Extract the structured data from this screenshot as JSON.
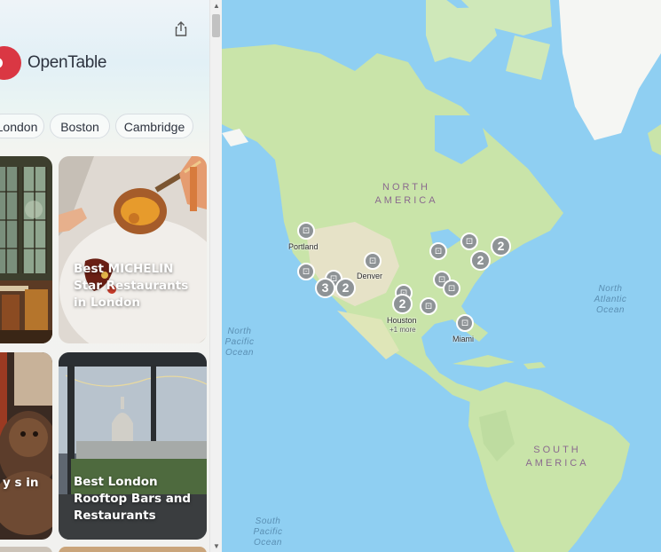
{
  "brand": {
    "name": "OpenTable",
    "accent": "#da3743"
  },
  "chips": [
    "London",
    "Boston",
    "Cambridge"
  ],
  "cards": [
    {
      "label": ""
    },
    {
      "label": "Best MICHELIN Star Restaurants in London"
    },
    {
      "label": "y s in"
    },
    {
      "label": "Best London Rooftop Bars and Restaurants"
    }
  ],
  "map": {
    "regions": {
      "north_america": "NORTH AMERICA",
      "south_america": "SOUTH AMERICA"
    },
    "oceans": {
      "north_pacific": "North Pacific Ocean",
      "north_atlantic": "North Atlantic Ocean",
      "south_pacific": "South Pacific Ocean"
    },
    "cities": {
      "portland": "Portland",
      "denver": "Denver",
      "houston": "Houston",
      "houston_more": "+1 more",
      "miami": "Miami"
    },
    "clusters": {
      "east_a": "2",
      "east_b": "2",
      "west_a": "3",
      "west_b": "2",
      "south_a": "2"
    },
    "icons": {
      "pin": "restaurant-icon",
      "share": "share-icon",
      "logo": "opentable-logo-icon"
    }
  }
}
